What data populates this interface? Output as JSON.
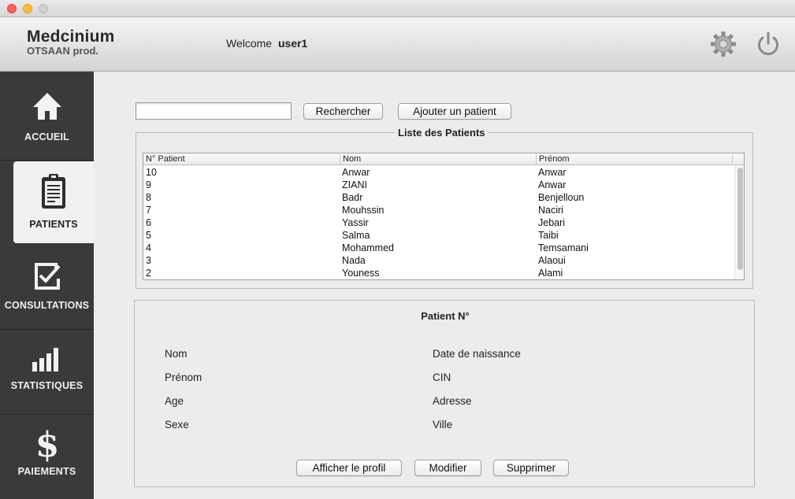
{
  "app": {
    "name": "Medcinium",
    "subtitle": "OTSAAN prod."
  },
  "header": {
    "welcome_text": "Welcome",
    "username": "user1",
    "settings_icon": "gear-icon",
    "power_icon": "power-icon"
  },
  "sidebar": {
    "items": [
      {
        "label": "ACCUEIL",
        "icon": "home-icon",
        "active": false
      },
      {
        "label": "PATIENTS",
        "icon": "clipboard-icon",
        "active": true
      },
      {
        "label": "CONSULTATIONS",
        "icon": "checkbox-icon",
        "active": false
      },
      {
        "label": "STATISTIQUES",
        "icon": "bar-chart-icon",
        "active": false
      },
      {
        "label": "PAIEMENTS",
        "icon": "dollar-icon",
        "active": false
      }
    ]
  },
  "search": {
    "value": "",
    "placeholder": "",
    "search_label": "Rechercher",
    "add_label": "Ajouter un patient"
  },
  "patient_list": {
    "title": "Liste des Patients",
    "columns": [
      "N° Patient",
      "Nom",
      "Prénom"
    ],
    "rows": [
      [
        "10",
        "Anwar",
        "Anwar"
      ],
      [
        "9",
        "ZIANI",
        "Anwar"
      ],
      [
        "8",
        "Badr",
        "Benjelloun"
      ],
      [
        "7",
        "Mouhssin",
        "Naciri"
      ],
      [
        "6",
        "Yassir",
        "Jebari"
      ],
      [
        "5",
        "Salma",
        "Taibi"
      ],
      [
        "4",
        "Mohammed",
        "Temsamani"
      ],
      [
        "3",
        "Nada",
        "Alaoui"
      ],
      [
        "2",
        "Youness",
        "Alami"
      ]
    ]
  },
  "patient_detail": {
    "title": "Patient N°",
    "left_fields": [
      "Nom",
      "Prénom",
      "Age",
      "Sexe"
    ],
    "right_fields": [
      "Date de naissance",
      "CIN",
      "Adresse",
      "Ville"
    ],
    "buttons": {
      "profile": "Afficher le profil",
      "edit": "Modifier",
      "delete": "Supprimer"
    }
  }
}
